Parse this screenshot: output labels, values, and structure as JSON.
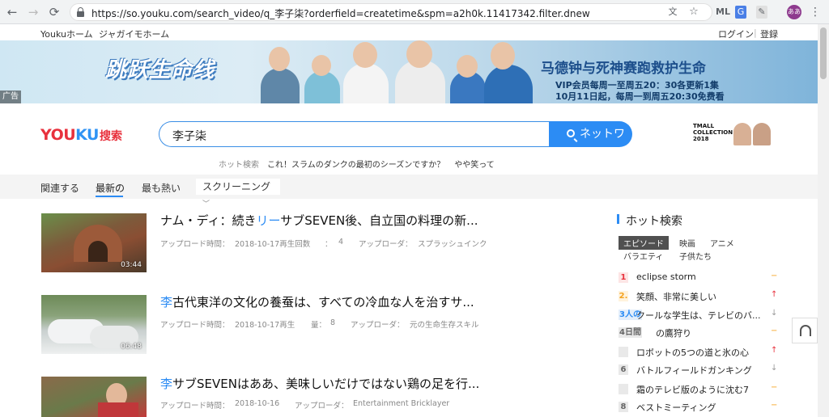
{
  "browser": {
    "url": "https://so.youku.com/search_video/q_李子柒?orderfield=createtime&spm=a2h0k.11417342.filter.dnew",
    "profile_initials": "ああ"
  },
  "topbar": {
    "home_youku": "Youkuホーム",
    "home_potato": "ジャガイモホーム",
    "login": "ログイン",
    "separator": "|",
    "register": "登録"
  },
  "banner": {
    "logo_text": "跳跃生命线",
    "title": "马德钟与死神赛跑救护生命",
    "line1": "VIP会员每周一至周五20：30各更新1集",
    "line2": "10月11日起，每周一到周五20:30免费看",
    "ad_tag": "广告"
  },
  "search": {
    "logo_you": "YOU",
    "logo_ku": "KU",
    "logo_suffix": "搜索",
    "query": "李子柒",
    "button_label": "ネットワ",
    "tmall_text": "TMALL COLLECTION 2018"
  },
  "hot_row": {
    "label": "ホット検索",
    "items": [
      "これ！スラムのダンクの最初のシーズンですか？",
      "やや笑って"
    ]
  },
  "tabs": {
    "related": "関連する",
    "newest": "最新の",
    "hottest": "最も熱い",
    "screening": "スクリーニング"
  },
  "results": [
    {
      "title_pre": "ナム・ディ：続き",
      "title_hl": "リー",
      "title_post": "サブSEVEN後、自立国の料理の新...",
      "duration": "03:44",
      "upload_label": "アップロード時間：",
      "upload_date": "2018-10-17再生回数",
      "plays_sep": "：",
      "plays": "4",
      "uploader_label": "アップローダ：",
      "uploader": "スプラッシュインク"
    },
    {
      "title_pre": "",
      "title_hl": "李",
      "title_post": "古代東洋の文化の養蚕は、すべての冷血な人を治すサ...",
      "duration": "06:48",
      "upload_label": "アップロード時間：",
      "upload_date": "2018-10-17再生",
      "plays_sep": "量：",
      "plays": "8",
      "uploader_label": "アップローダ：",
      "uploader": "元の生命生存スキル"
    },
    {
      "title_pre": "",
      "title_hl": "李",
      "title_post": "サブSEVENはああ、美味しいだけではない鶏の足を行...",
      "duration": "",
      "upload_label": "アップロード時間：",
      "upload_date": "2018-10-16",
      "plays_sep": "",
      "plays": "",
      "uploader_label": "アップローダ：",
      "uploader": "Entertainment Bricklayer"
    }
  ],
  "hot_search": {
    "title": "ホット検索",
    "categories": [
      "エピソード",
      "映画",
      "アニメ",
      "バラエティ",
      "子供たち"
    ],
    "items": [
      {
        "rank": "1",
        "text": "eclipse storm",
        "trend": "flat"
      },
      {
        "rank": "2.",
        "text": "笑顔、非常に美しい",
        "trend": "up"
      },
      {
        "rank": "3人の",
        "text": "クールな学生は、テレビのバ...",
        "trend": "down"
      },
      {
        "rank": "4日間",
        "text": "の鷹狩り",
        "trend": "flat"
      },
      {
        "rank": "",
        "text": "ロボットの5つの道と氷の心",
        "trend": "up"
      },
      {
        "rank": "6",
        "text": "バトルフィールドガンキング",
        "trend": "down"
      },
      {
        "rank": "",
        "text": "霜のテレビ版のように沈む7",
        "trend": "flat"
      },
      {
        "rank": "8",
        "text": "ベストミーティング",
        "trend": "flat"
      }
    ]
  }
}
